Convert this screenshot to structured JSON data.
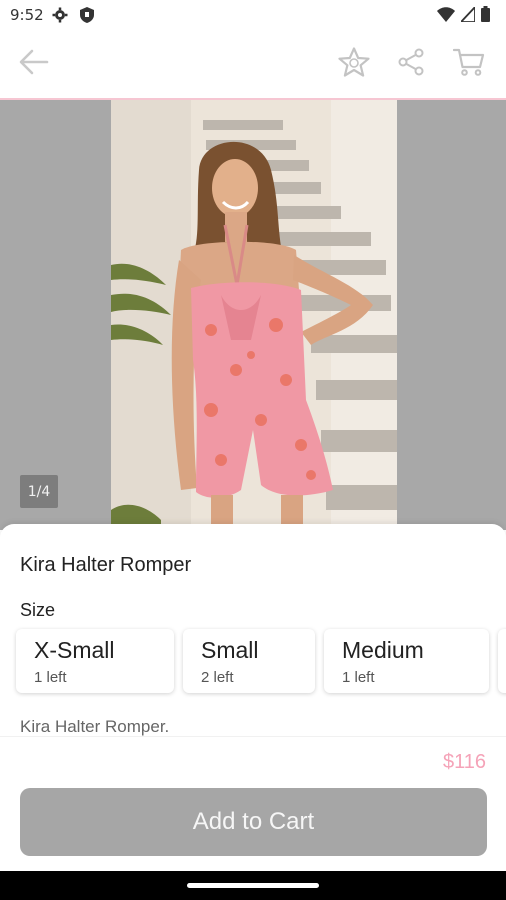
{
  "status": {
    "time": "9:52"
  },
  "topbar": {
    "back_icon": "arrow-left-icon",
    "favorite_icon": "star-icon",
    "share_icon": "share-icon",
    "cart_icon": "cart-icon"
  },
  "gallery": {
    "counter": "1/4"
  },
  "product": {
    "title": "Kira Halter Romper",
    "size_label": "Size",
    "sizes": [
      {
        "name": "X-Small",
        "stock": "1 left"
      },
      {
        "name": "Small",
        "stock": "2 left"
      },
      {
        "name": "Medium",
        "stock": "1 left"
      }
    ],
    "description": "Kira Halter Romper."
  },
  "footer": {
    "price": "$116",
    "add_to_cart": "Add to Cart"
  },
  "colors": {
    "accent_pink": "#f5a3b8",
    "button_gray": "#a6a6a6"
  }
}
